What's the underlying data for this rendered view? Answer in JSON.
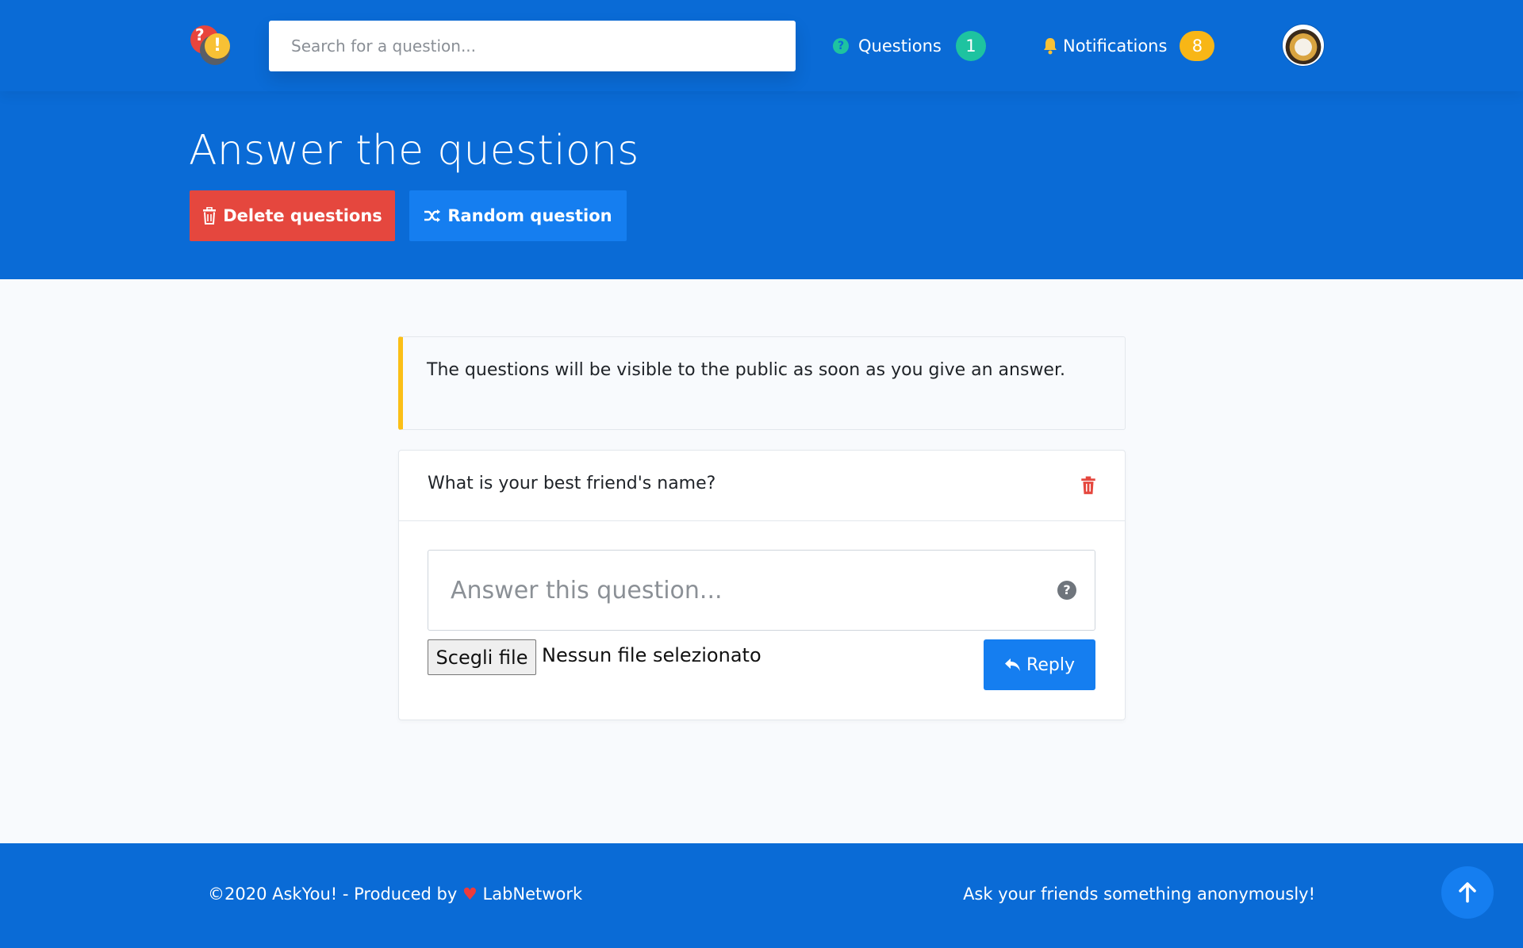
{
  "header": {
    "search_placeholder": "Search for a question...",
    "questions_label": "Questions",
    "questions_count": "1",
    "notifications_label": "Notifications",
    "notifications_count": "8"
  },
  "hero": {
    "title": "Answer the questions",
    "delete_label": "Delete questions",
    "random_label": "Random question"
  },
  "alert": {
    "text": "The questions will be visible to the public as soon as you give an answer."
  },
  "question_card": {
    "title": "What is your best friend's name?",
    "answer_placeholder": "Answer this question...",
    "file_button": "Scegli file",
    "file_status": "Nessun file selezionato",
    "reply_label": "Reply"
  },
  "footer": {
    "copyright_prefix": "©2020 AskYou! - Produced by",
    "heart": "♥",
    "producer": "LabNetwork",
    "tagline": "Ask your friends something anonymously!"
  },
  "colors": {
    "brand_blue": "#0a6bd6",
    "button_blue": "#157ef0",
    "danger_red": "#e5473e",
    "success_green": "#1ec3a0",
    "warning_yellow": "#f8b616"
  }
}
